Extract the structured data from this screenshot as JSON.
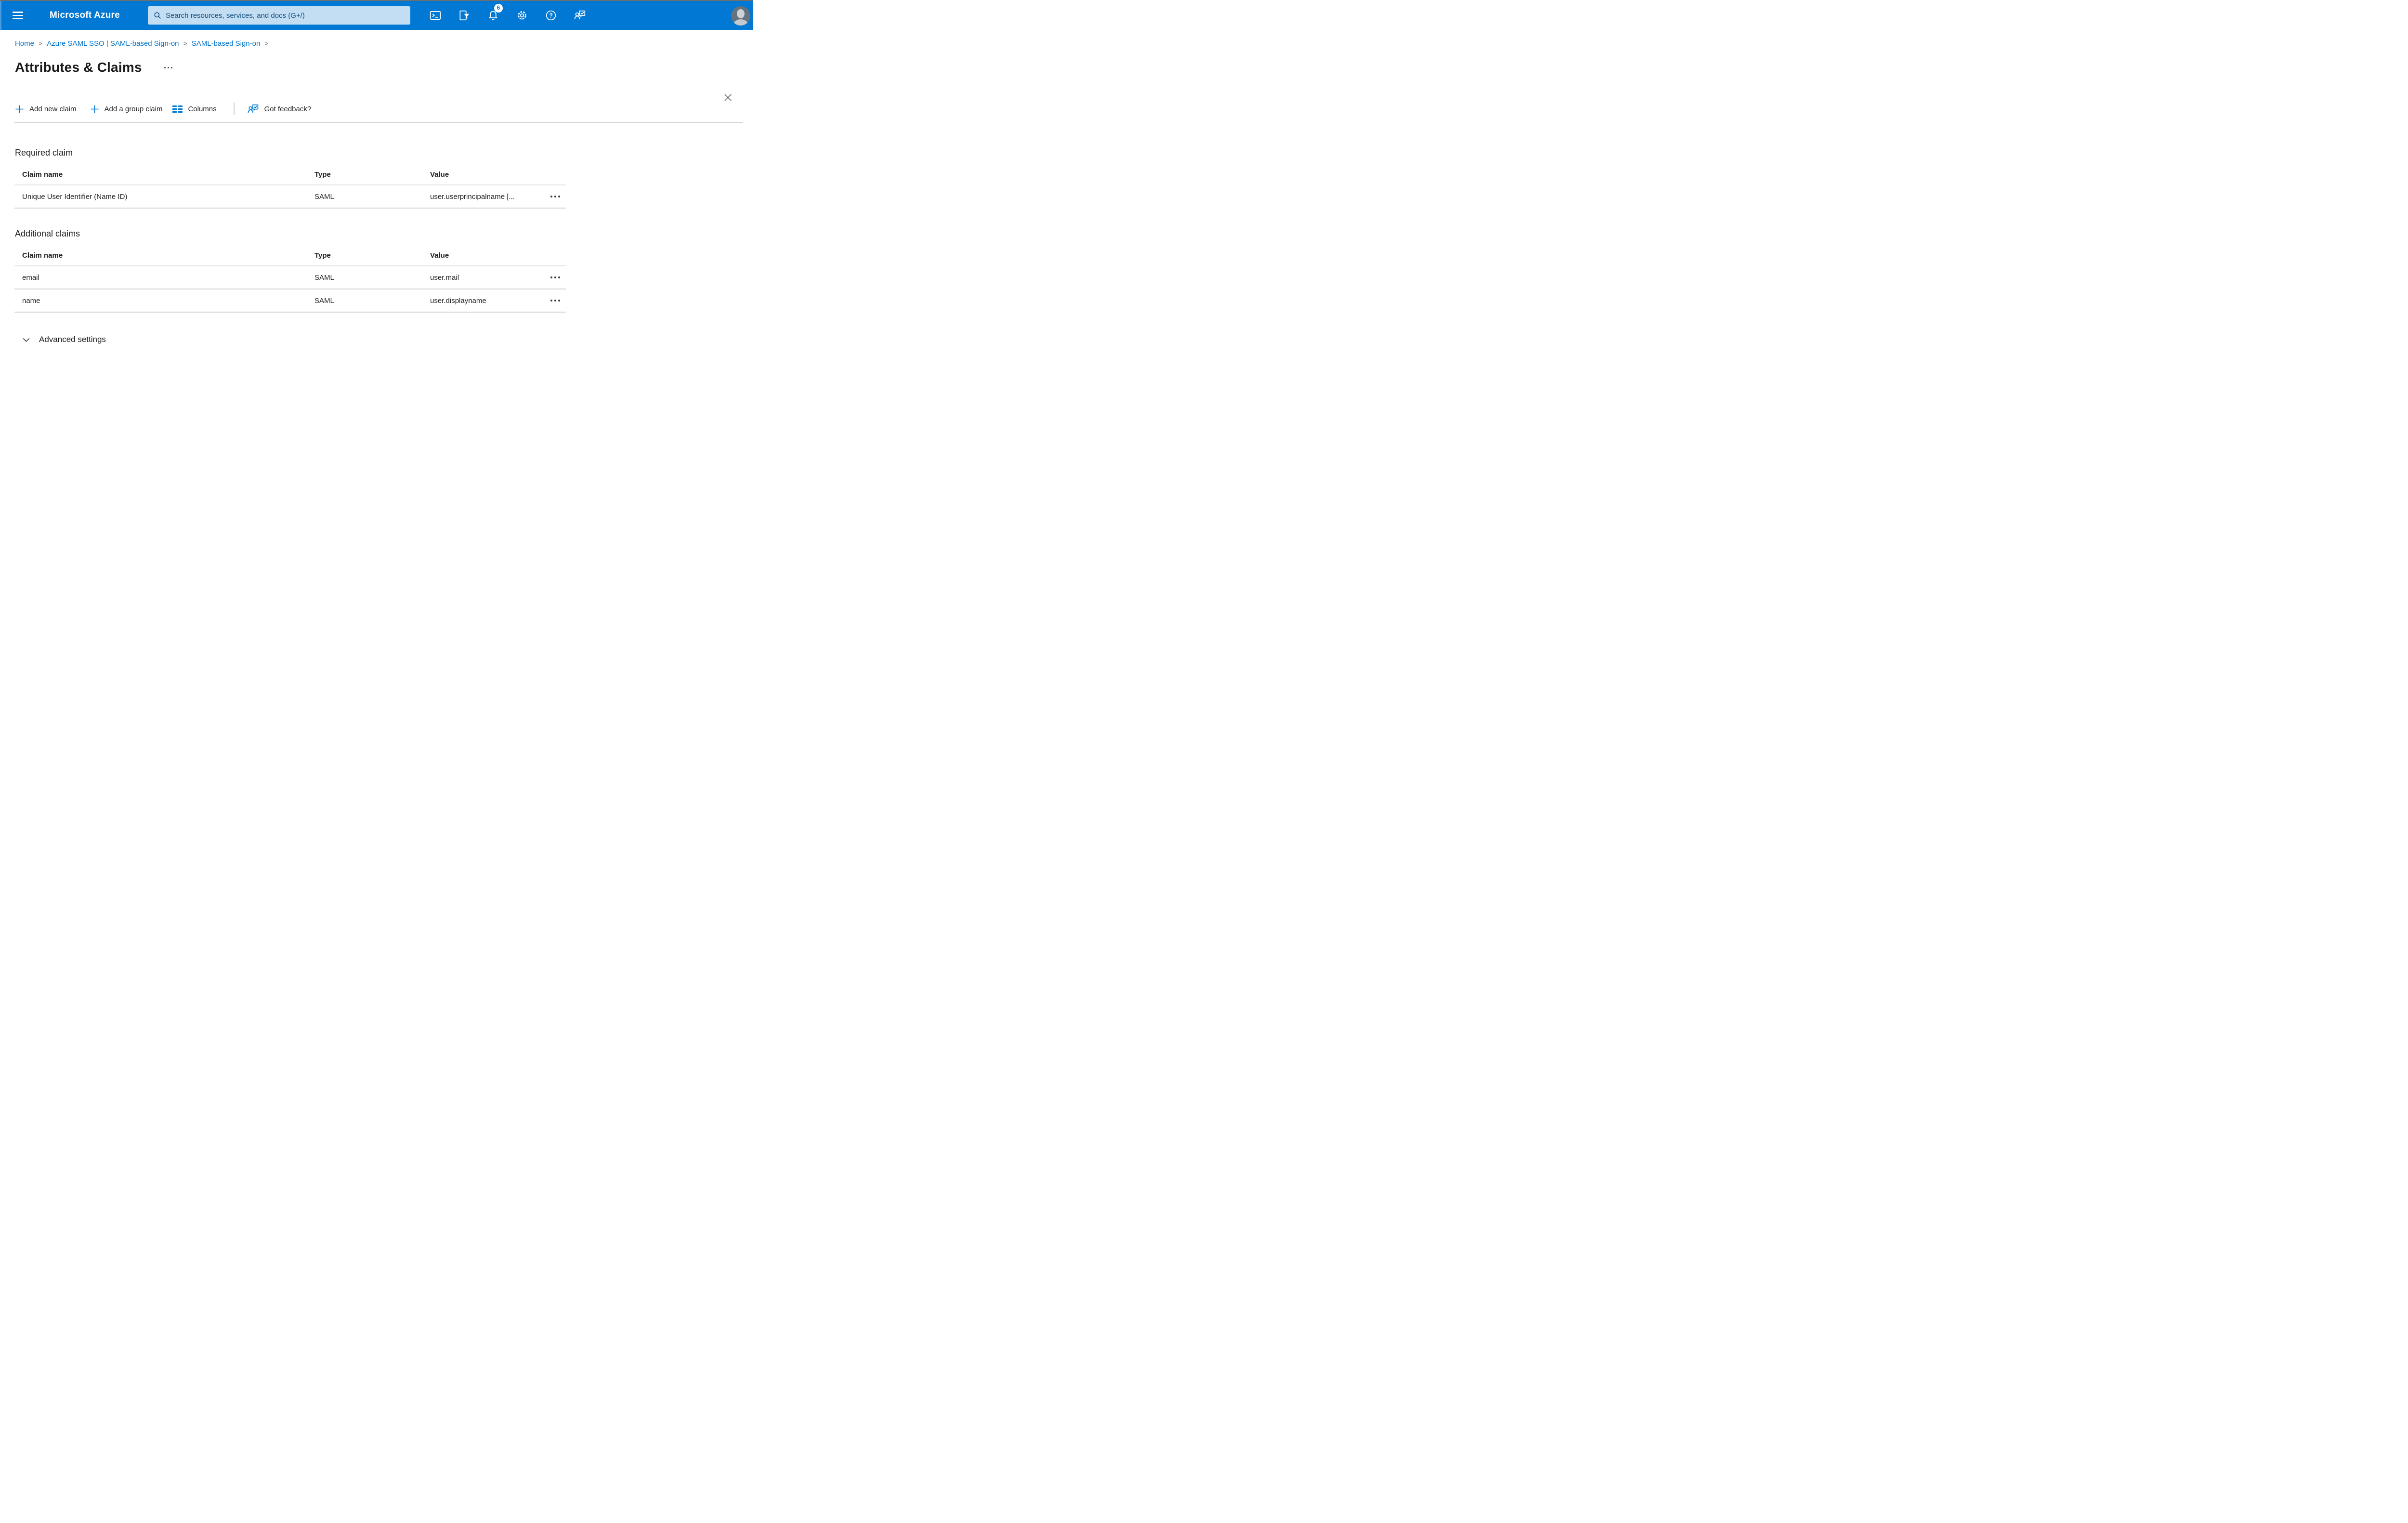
{
  "topbar": {
    "brand": "Microsoft Azure",
    "search": {
      "placeholder": "Search resources, services, and docs (G+/)",
      "value": ""
    },
    "notifications_badge": "6",
    "icons": [
      "hamburger-menu-icon",
      "search-icon",
      "cloud-shell-icon",
      "directory-filter-icon",
      "notifications-bell-icon",
      "settings-gear-icon",
      "help-icon",
      "feedback-icon",
      "avatar"
    ]
  },
  "breadcrumb": {
    "separator": ">",
    "items": [
      "Home",
      "Azure SAML SSO | SAML-based Sign-on",
      "SAML-based Sign-on"
    ]
  },
  "page": {
    "title": "Attributes & Claims"
  },
  "toolbar": {
    "add_new_claim": "Add new claim",
    "add_group_claim": "Add a group claim",
    "columns": "Columns",
    "got_feedback": "Got feedback?"
  },
  "required_claim": {
    "heading": "Required claim",
    "columns": [
      "Claim name",
      "Type",
      "Value"
    ],
    "rows": [
      {
        "claim_name": "Unique User Identifier (Name ID)",
        "type": "SAML",
        "value": "user.userprincipalname [..."
      }
    ]
  },
  "additional_claims": {
    "heading": "Additional claims",
    "columns": [
      "Claim name",
      "Type",
      "Value"
    ],
    "rows": [
      {
        "claim_name": "email",
        "type": "SAML",
        "value": "user.mail"
      },
      {
        "claim_name": "name",
        "type": "SAML",
        "value": "user.displayname"
      }
    ]
  },
  "advanced_settings": {
    "label": "Advanced settings"
  },
  "colors": {
    "topbar_bg": "#0078d4",
    "accent": "#0078d4",
    "search_bg": "#c3ddf3",
    "search_text": "#12507f",
    "breadcrumb_link": "#0072c9",
    "title_text": "#1a1a1a",
    "divider": "#d6d6d6",
    "badge_bg": "#ffffff",
    "badge_text": "#0078d4"
  }
}
